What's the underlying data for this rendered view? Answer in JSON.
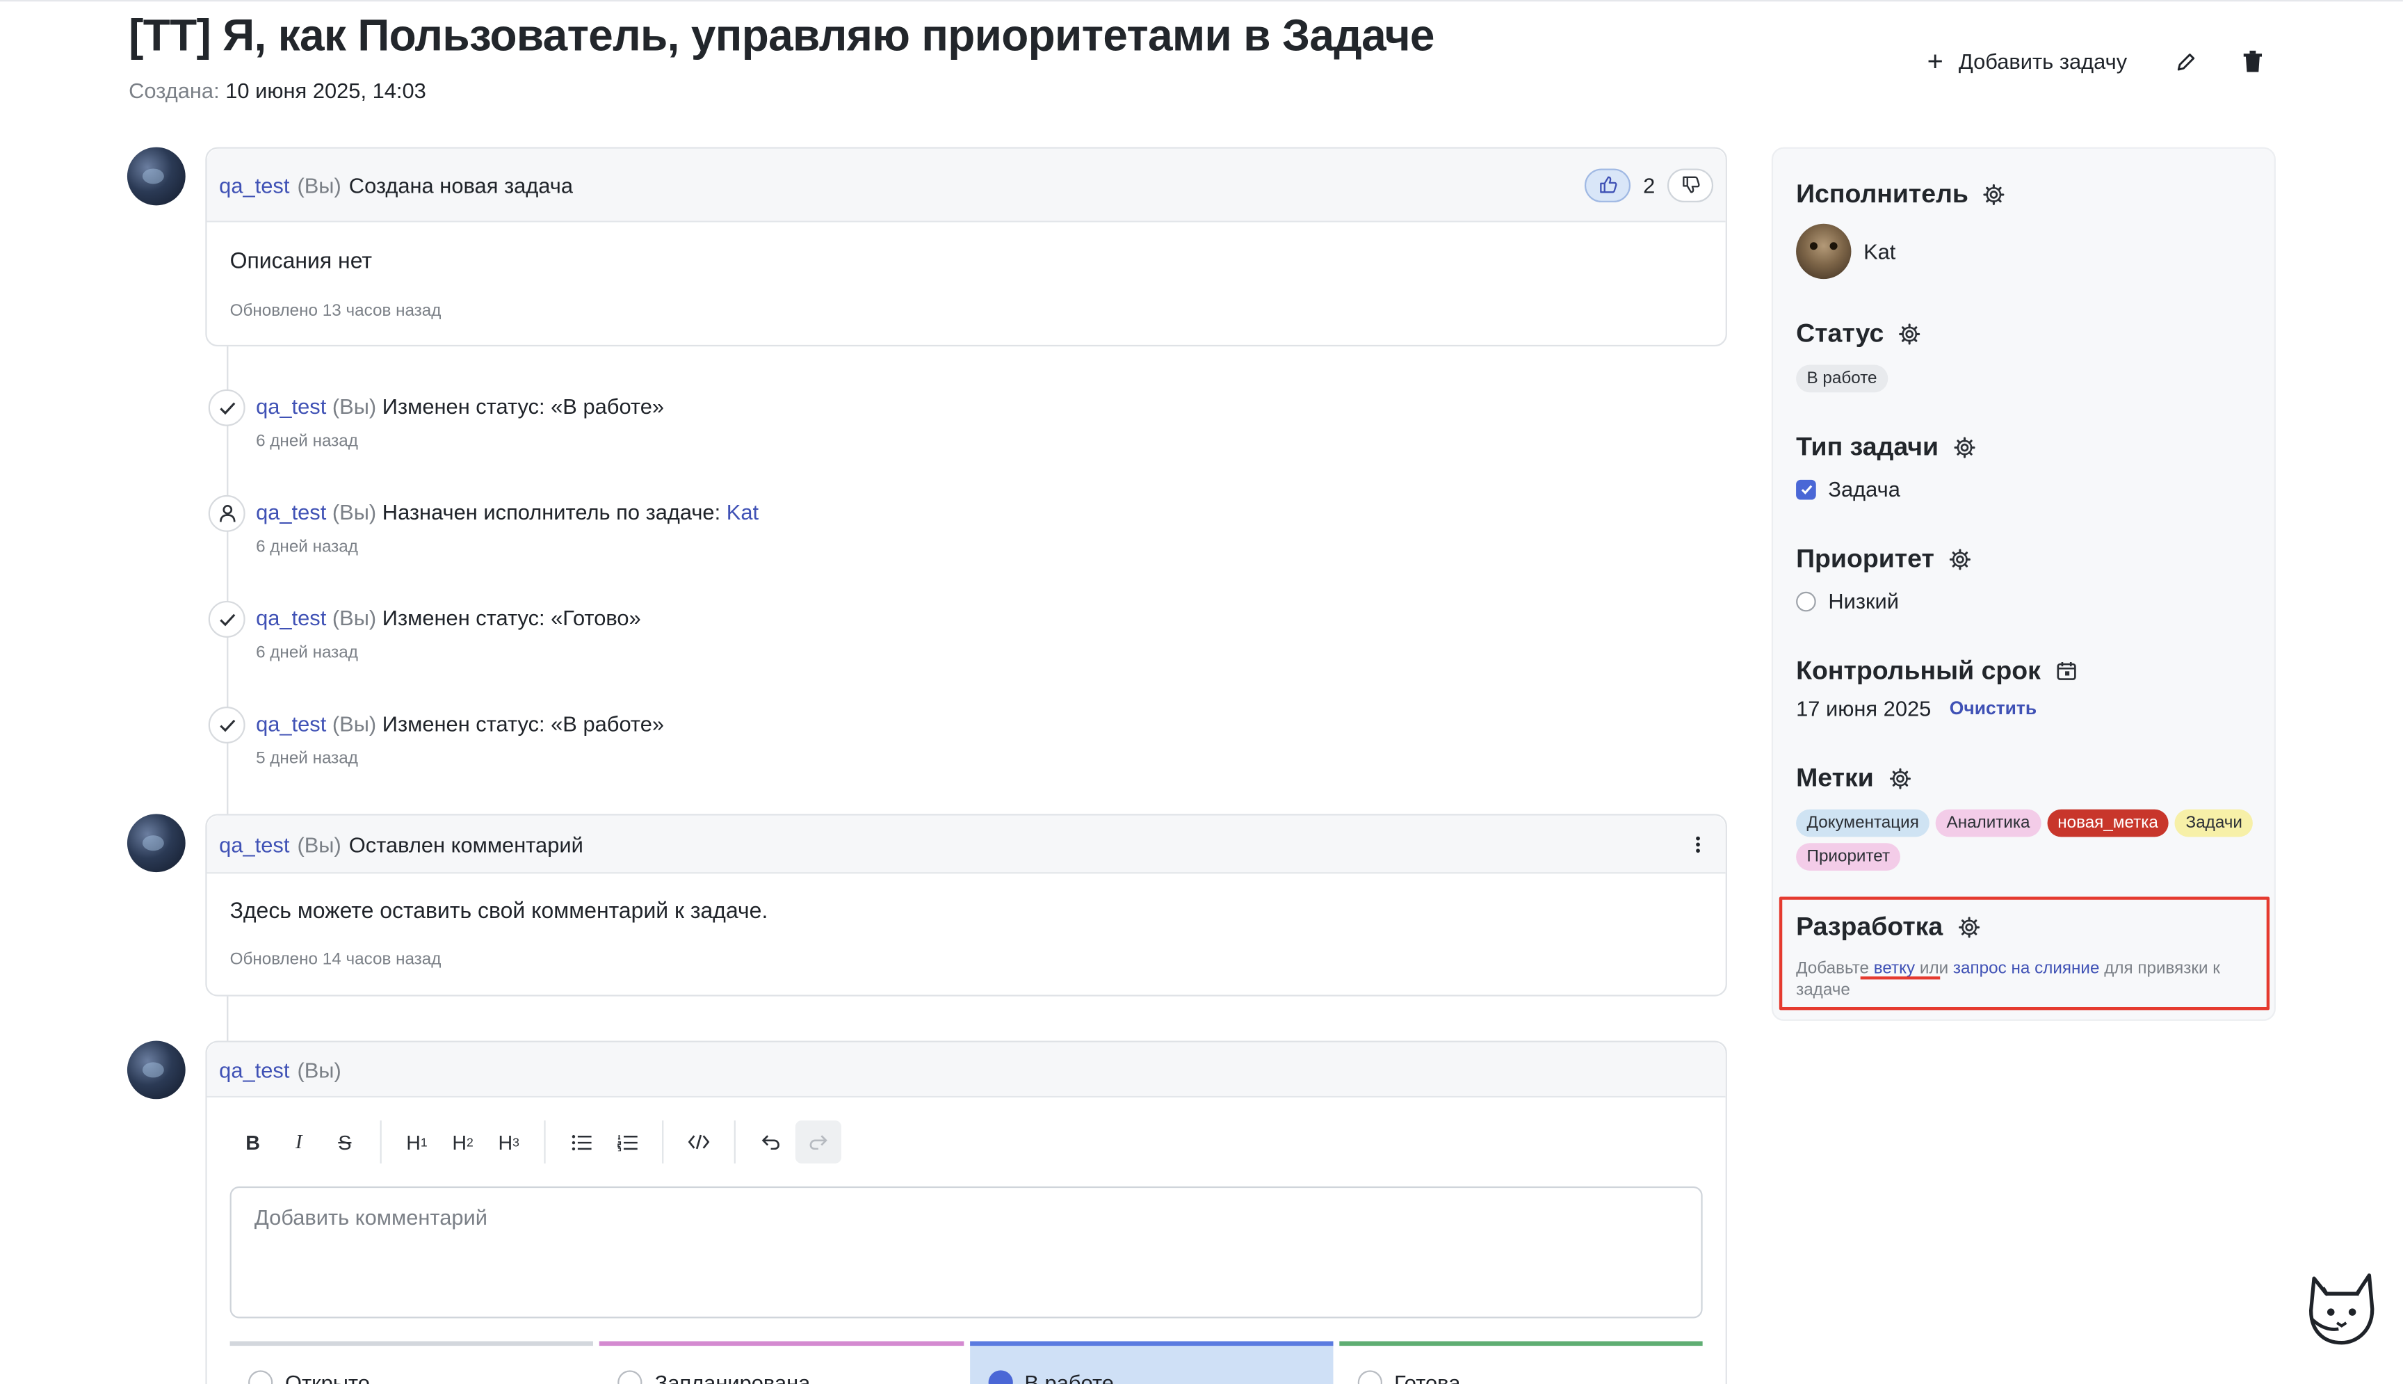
{
  "header": {
    "title": "[TT] Я, как Пользователь, управляю приоритетами в Задаче",
    "created_label": "Создана:",
    "created_value": "10 июня 2025, 14:03",
    "add_task_label": "Добавить задачу"
  },
  "description_card": {
    "user": "qa_test",
    "you": "(Вы)",
    "action": "Создана новая задача",
    "likes": "2",
    "text": "Описания нет",
    "updated": "Обновлено 13 часов назад"
  },
  "events": [
    {
      "user": "qa_test",
      "you": "(Вы)",
      "text": "Изменен статус: «В работе»",
      "time": "6 дней назад",
      "icon": "check-icon"
    },
    {
      "user": "qa_test",
      "you": "(Вы)",
      "text": "Назначен исполнитель по задаче:",
      "link": "Kat",
      "time": "6 дней назад",
      "icon": "user-icon"
    },
    {
      "user": "qa_test",
      "you": "(Вы)",
      "text": "Изменен статус: «Готово»",
      "time": "6 дней назад",
      "icon": "check-icon"
    },
    {
      "user": "qa_test",
      "you": "(Вы)",
      "text": "Изменен статус: «В работе»",
      "time": "5 дней назад",
      "icon": "check-icon"
    }
  ],
  "comment_card": {
    "user": "qa_test",
    "you": "(Вы)",
    "action": "Оставлен комментарий",
    "text": "Здесь можете оставить свой комментарий к задаче.",
    "updated": "Обновлено 14 часов назад"
  },
  "editor": {
    "user": "qa_test",
    "you": "(Вы)",
    "toolbar": {
      "bold": "B",
      "italic": "I",
      "strike": "S",
      "h1": "H",
      "h2": "H",
      "h3": "H",
      "h1_sub": "1",
      "h2_sub": "2",
      "h3_sub": "3"
    },
    "placeholder": "Добавить комментарий",
    "statuses": [
      {
        "label": "Открыто",
        "color": "#d3d7dd"
      },
      {
        "label": "Запланирована",
        "color": "#d48ad0"
      },
      {
        "label": "В работе",
        "color": "#5b7be0"
      },
      {
        "label": "Готова",
        "color": "#5fae73"
      }
    ]
  },
  "sidebar": {
    "assignee_title": "Исполнитель",
    "assignee_name": "Kat",
    "status_title": "Статус",
    "status_value": "В работе",
    "type_title": "Тип задачи",
    "type_value": "Задача",
    "priority_title": "Приоритет",
    "priority_value": "Низкий",
    "deadline_title": "Контрольный срок",
    "deadline_value": "17 июня 2025",
    "deadline_clear": "Очистить",
    "tags_title": "Метки",
    "tags": [
      {
        "label": "Документация",
        "bg": "#cfe3f3"
      },
      {
        "label": "Аналитика",
        "bg": "#f3cce8"
      },
      {
        "label": "новая_метка",
        "bg": "#c8362b",
        "fg": "#ffffff"
      },
      {
        "label": "Задачи",
        "bg": "#f7f0a8"
      },
      {
        "label": "Приоритет",
        "bg": "#f3cce8"
      }
    ],
    "dev_title": "Разработка",
    "dev_text_1": "Добавьте",
    "dev_link_branch": "ветку",
    "dev_text_2": "или",
    "dev_link_mr": "запрос на слияние",
    "dev_text_3": "для привязки к задаче"
  }
}
